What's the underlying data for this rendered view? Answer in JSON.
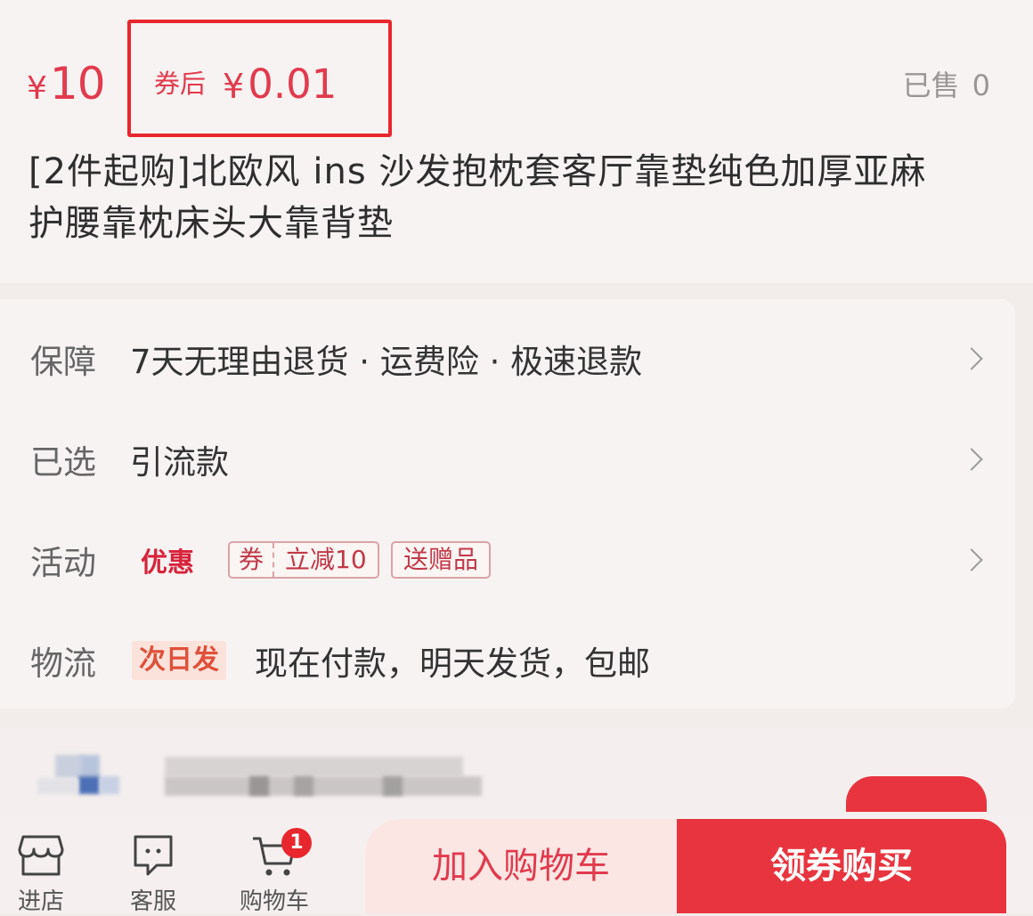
{
  "price": {
    "currency": "¥",
    "amount": "10",
    "coupon_label": "券后",
    "coupon_amount": "0.01",
    "sold_label": "已售",
    "sold_count": "0"
  },
  "product": {
    "title_line1": "[2件起购]北欧风 ins 沙发抱枕套客厅靠垫纯色加厚亚麻",
    "title_line2": "护腰靠枕床头大靠背垫"
  },
  "info": {
    "guarantee": {
      "label": "保障",
      "value": "7天无理由退货 · 运费险 · 极速退款"
    },
    "selected": {
      "label": "已选",
      "value": "引流款"
    },
    "activity": {
      "label": "活动",
      "promo_tag": "优惠",
      "coupon_left": "券",
      "coupon_right": "立减10",
      "gift": "送赠品"
    },
    "logistics": {
      "label": "物流",
      "tag": "次日发",
      "value": "现在付款，明天发货，包邮"
    }
  },
  "bottom_bar": {
    "store": "进店",
    "service": "客服",
    "cart": "购物车",
    "cart_badge": "1",
    "add_to_cart": "加入购物车",
    "buy": "领券购买"
  },
  "colors": {
    "accent": "#e23a4e",
    "highlight_box": "#e8262e",
    "buy_button": "#e8343f"
  }
}
